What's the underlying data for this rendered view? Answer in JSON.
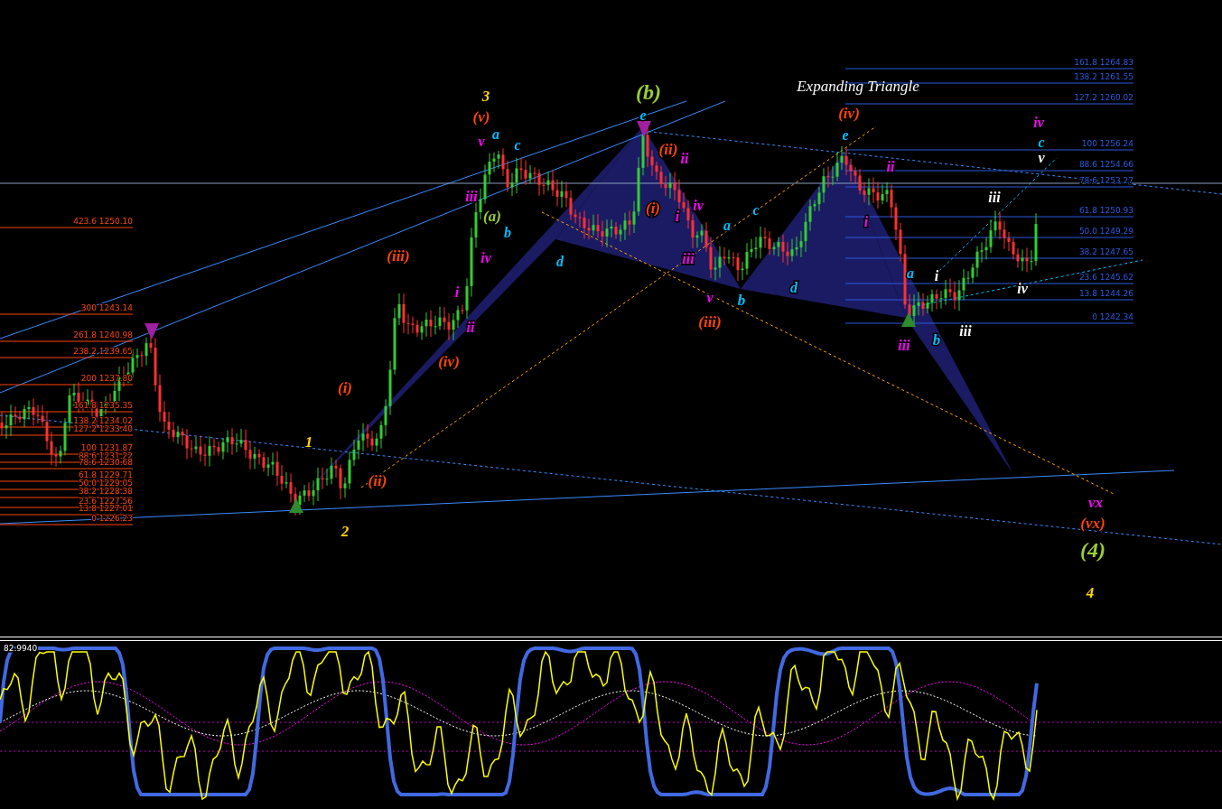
{
  "main_chart": {
    "pattern_title": "Expanding Triangle",
    "wave_labels": [
      {
        "text": "(b)",
        "color": "#9acd32"
      },
      {
        "text": "3",
        "color": "#ffd700"
      },
      {
        "text": "(v)",
        "color": "#ff4500"
      },
      {
        "text": "e",
        "color": "#00bfff"
      },
      {
        "text": "(iv)",
        "color": "#ff4500"
      },
      {
        "text": "iv",
        "color": "#ff00ff"
      },
      {
        "text": "v",
        "color": "#ff00ff"
      },
      {
        "text": "a",
        "color": "#00bfff"
      },
      {
        "text": "c",
        "color": "#00bfff"
      },
      {
        "text": "e",
        "color": "#00bfff"
      },
      {
        "text": "c",
        "color": "#00bfff"
      },
      {
        "text": "(ii)",
        "color": "#ff4500"
      },
      {
        "text": "ii",
        "color": "#ff00ff"
      },
      {
        "text": "v",
        "color": "#ffffff"
      },
      {
        "text": "ii",
        "color": "#ff00ff"
      },
      {
        "text": "iii",
        "color": "#ff00ff"
      },
      {
        "text": "(i)",
        "color": "#ff4500"
      },
      {
        "text": "iv",
        "color": "#ff00ff"
      },
      {
        "text": "c",
        "color": "#00bfff"
      },
      {
        "text": "iii",
        "color": "#ffffff"
      },
      {
        "text": "(a)",
        "color": "#9acd32"
      },
      {
        "text": "b",
        "color": "#00bfff"
      },
      {
        "text": "i",
        "color": "#ff00ff"
      },
      {
        "text": "a",
        "color": "#00bfff"
      },
      {
        "text": "i",
        "color": "#ff00ff"
      },
      {
        "text": "(iii)",
        "color": "#ff4500"
      },
      {
        "text": "iv",
        "color": "#ff00ff"
      },
      {
        "text": "d",
        "color": "#00bfff"
      },
      {
        "text": "iii",
        "color": "#ff00ff"
      },
      {
        "text": "a",
        "color": "#00bfff"
      },
      {
        "text": "i",
        "color": "#ffffff"
      },
      {
        "text": "i",
        "color": "#ff00ff"
      },
      {
        "text": "v",
        "color": "#ff00ff"
      },
      {
        "text": "b",
        "color": "#00bfff"
      },
      {
        "text": "d",
        "color": "#00bfff"
      },
      {
        "text": "iv",
        "color": "#ffffff"
      },
      {
        "text": "ii",
        "color": "#ff00ff"
      },
      {
        "text": "(iii)",
        "color": "#ff4500"
      },
      {
        "text": "iii",
        "color": "#ff00ff"
      },
      {
        "text": "b",
        "color": "#00bfff"
      },
      {
        "text": "iii",
        "color": "#ffffff"
      },
      {
        "text": "(iv)",
        "color": "#ff4500"
      },
      {
        "text": "(i)",
        "color": "#ff4500"
      },
      {
        "text": "1",
        "color": "#ffd700"
      },
      {
        "text": "(ii)",
        "color": "#ff4500"
      },
      {
        "text": "vx",
        "color": "#ff00ff"
      },
      {
        "text": "(vx)",
        "color": "#ff4500"
      },
      {
        "text": "2",
        "color": "#ffd700"
      },
      {
        "text": "(4)",
        "color": "#9acd32"
      },
      {
        "text": "4",
        "color": "#ffd700"
      }
    ],
    "fib_right": [
      "161.8 1264.83",
      "138.2 1261.55",
      "127.2 1260.02",
      "100 1256.24",
      "88.6 1254.66",
      "78.6 1253.27",
      "61.8 1250.93",
      "50.0 1249.29",
      "38.2 1247.65",
      "23.6 1245.62",
      "13.8 1244.26",
      "0 1242.34"
    ],
    "fib_left": [
      "423.6 1250.10",
      "300 1243.14",
      "261.8 1240.98",
      "238.2 1239.65",
      "200 1237.80",
      "161.8 1235.35",
      "138.2 1234.02",
      "127.2 1233.40",
      "100 1231.87",
      "88.6 1231.22",
      "78.6 1230.68",
      "61.8 1229.71",
      "50.0 1229.05",
      "38.2 1228.38",
      "23.6 1227.56",
      "13.8 1227.01",
      "0 1226.23"
    ]
  },
  "oscillator": {
    "reading": "82.9940"
  }
}
